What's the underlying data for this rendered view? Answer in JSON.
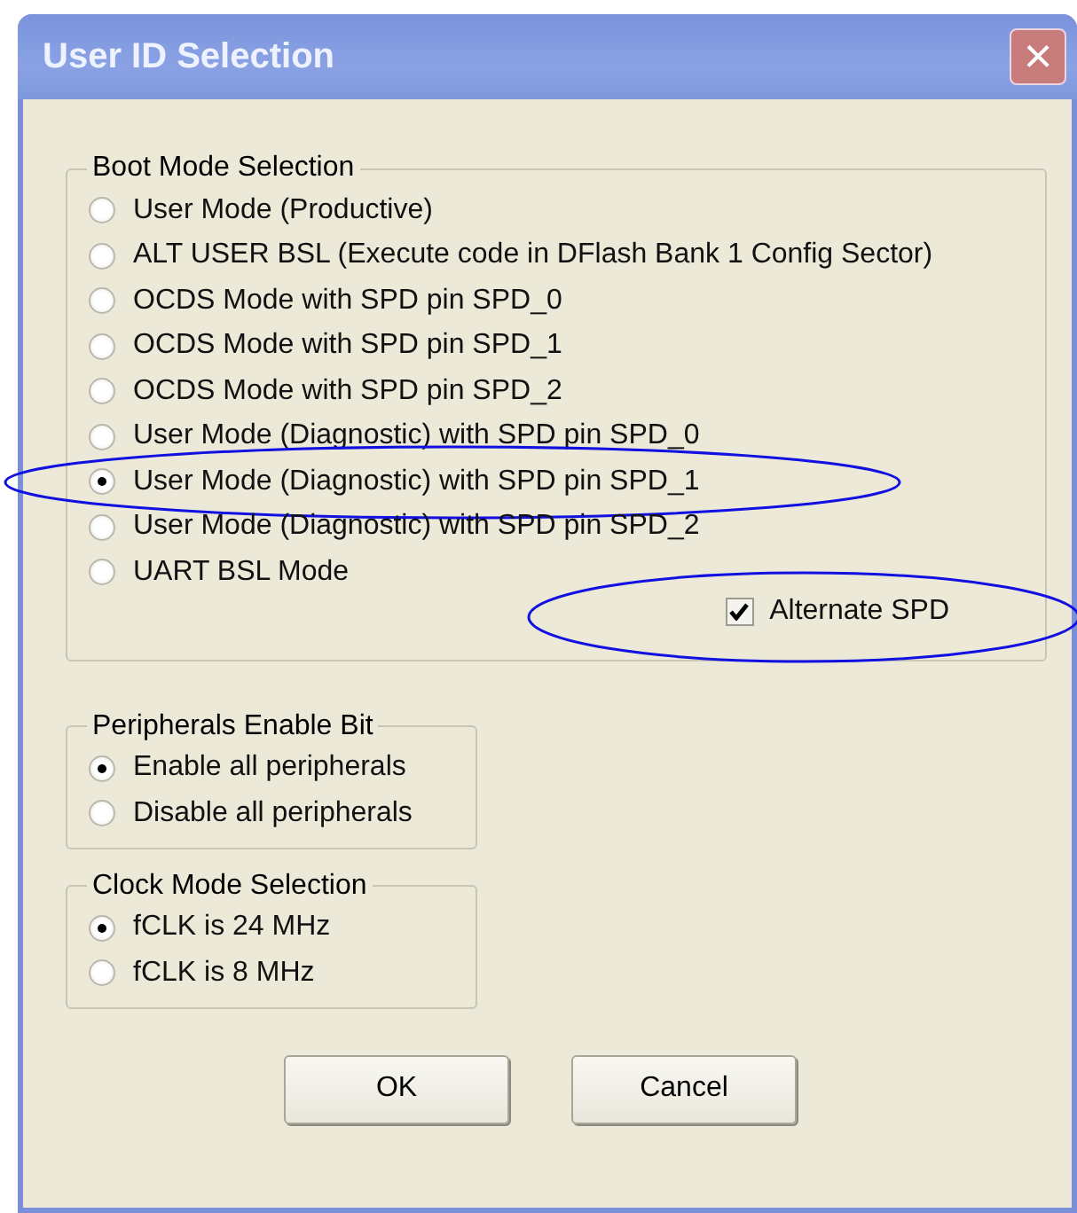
{
  "window": {
    "title": "User ID Selection",
    "close": "×"
  },
  "boot_mode": {
    "title": "Boot Mode Selection",
    "options": [
      {
        "label": "User Mode (Productive)",
        "selected": false,
        "highlighted": false
      },
      {
        "label": "ALT USER BSL (Execute code in DFlash Bank 1 Config Sector)",
        "selected": false,
        "highlighted": false
      },
      {
        "label": "OCDS Mode with SPD pin SPD_0",
        "selected": false,
        "highlighted": false
      },
      {
        "label": "OCDS Mode with SPD pin SPD_1",
        "selected": false,
        "highlighted": false
      },
      {
        "label": "OCDS Mode with SPD pin SPD_2",
        "selected": false,
        "highlighted": false
      },
      {
        "label": "User Mode (Diagnostic) with SPD pin SPD_0",
        "selected": false,
        "highlighted": false
      },
      {
        "label": "User Mode (Diagnostic) with SPD pin SPD_1",
        "selected": true,
        "highlighted": true
      },
      {
        "label": "User Mode (Diagnostic) with SPD pin SPD_2",
        "selected": false,
        "highlighted": false
      },
      {
        "label": "UART BSL Mode",
        "selected": false,
        "highlighted": false
      }
    ],
    "alternate_spd": {
      "label": "Alternate SPD",
      "checked": true,
      "highlighted": true
    }
  },
  "peripherals": {
    "title": "Peripherals Enable Bit",
    "options": [
      {
        "label": "Enable all peripherals",
        "selected": true,
        "highlighted": false
      },
      {
        "label": "Disable all peripherals",
        "selected": false,
        "highlighted": false
      }
    ]
  },
  "clock_mode": {
    "title": "Clock Mode Selection",
    "options": [
      {
        "label": "fCLK is 24 MHz",
        "selected": true,
        "highlighted": false
      },
      {
        "label": "fCLK is 8 MHz",
        "selected": false,
        "highlighted": false
      }
    ]
  },
  "buttons": [
    "OK",
    "Cancel"
  ]
}
